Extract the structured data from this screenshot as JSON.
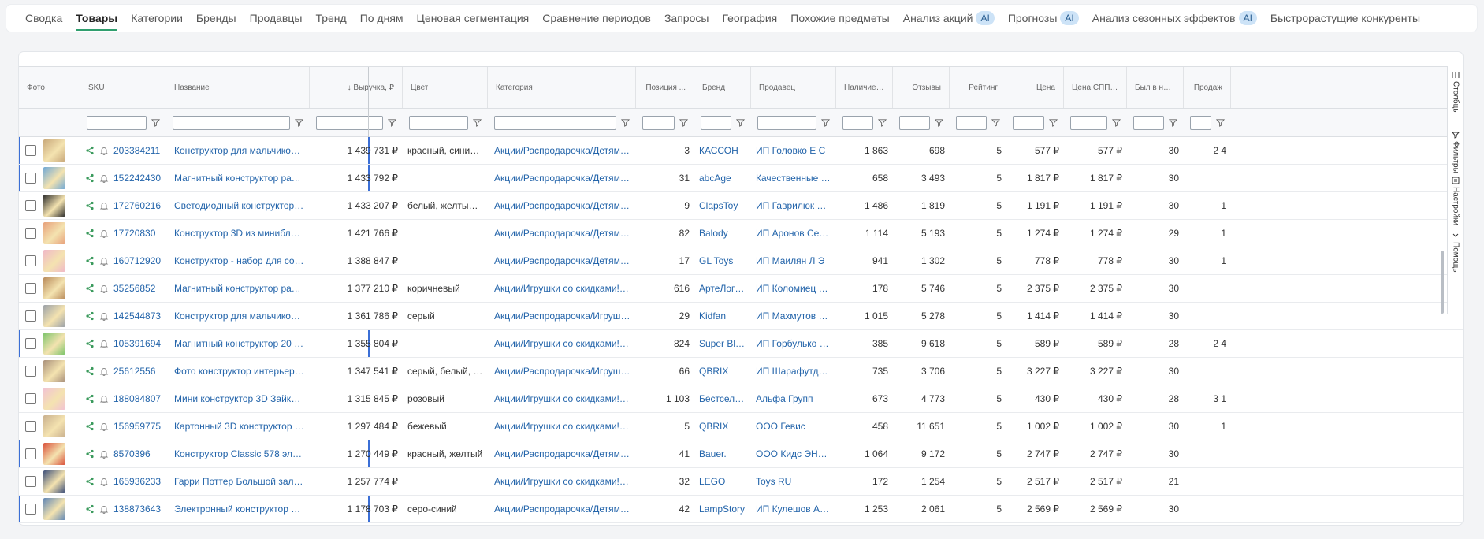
{
  "tabs": [
    {
      "label": "Сводка",
      "active": false,
      "ai": false
    },
    {
      "label": "Товары",
      "active": true,
      "ai": false
    },
    {
      "label": "Категории",
      "active": false,
      "ai": false
    },
    {
      "label": "Бренды",
      "active": false,
      "ai": false
    },
    {
      "label": "Продавцы",
      "active": false,
      "ai": false
    },
    {
      "label": "Тренд",
      "active": false,
      "ai": false
    },
    {
      "label": "По дням",
      "active": false,
      "ai": false
    },
    {
      "label": "Ценовая сегментация",
      "active": false,
      "ai": false
    },
    {
      "label": "Сравнение периодов",
      "active": false,
      "ai": false
    },
    {
      "label": "Запросы",
      "active": false,
      "ai": false
    },
    {
      "label": "География",
      "active": false,
      "ai": false
    },
    {
      "label": "Похожие предметы",
      "active": false,
      "ai": false
    },
    {
      "label": "Анализ акций",
      "active": false,
      "ai": true
    },
    {
      "label": "Прогнозы",
      "active": false,
      "ai": true
    },
    {
      "label": "Анализ сезонных эффектов",
      "active": false,
      "ai": true
    },
    {
      "label": "Быстрорастущие конкуренты",
      "active": false,
      "ai": false
    }
  ],
  "ai_label": "AI",
  "columns": [
    {
      "key": "photo",
      "label": "Фото",
      "filter": false
    },
    {
      "key": "sku",
      "label": "SKU",
      "filter": true
    },
    {
      "key": "name",
      "label": "Название",
      "filter": true
    },
    {
      "key": "revenue",
      "label": "↓ Выручка, ₽",
      "filter": true
    },
    {
      "key": "color",
      "label": "Цвет",
      "filter": true
    },
    {
      "key": "category",
      "label": "Категория",
      "filter": true
    },
    {
      "key": "position",
      "label": "Позиция ...",
      "filter": true
    },
    {
      "key": "brand",
      "label": "Бренд",
      "filter": true
    },
    {
      "key": "seller",
      "label": "Продавец",
      "filter": true
    },
    {
      "key": "stock",
      "label": "Наличие, ...",
      "filter": true
    },
    {
      "key": "reviews",
      "label": "Отзывы",
      "filter": true
    },
    {
      "key": "rating",
      "label": "Рейтинг",
      "filter": true
    },
    {
      "key": "price",
      "label": "Цена",
      "filter": true
    },
    {
      "key": "price_spp",
      "label": "Цена СПП, ₽",
      "filter": true
    },
    {
      "key": "days",
      "label": "Был в нал...",
      "filter": true
    },
    {
      "key": "sales",
      "label": "Продаж",
      "filter": true
    }
  ],
  "rows": [
    {
      "sku": "203384211",
      "name": "Конструктор для мальчиков дево...",
      "revenue": "1 439 731 ₽",
      "color": "красный, синий, ...",
      "category": "Акции/Распродарочка/Детям/Под...",
      "position": "3",
      "brand": "КАССОН",
      "seller": "ИП Головко Е С",
      "stock": "1 863",
      "reviews": "698",
      "rating": "5",
      "price": "577 ₽",
      "price_spp": "577 ₽",
      "days": "30",
      "sales": "2 4",
      "pinned": true,
      "thumb": "#c8a87a"
    },
    {
      "sku": "152242430",
      "name": "Магнитный конструктор развива...",
      "revenue": "1 433 792 ₽",
      "color": "",
      "category": "Акции/Распродарочка/Детям/Под...",
      "position": "31",
      "brand": "abcAge",
      "seller": "Качественные Тов...",
      "stock": "658",
      "reviews": "3 493",
      "rating": "5",
      "price": "1 817 ₽",
      "price_spp": "1 817 ₽",
      "days": "30",
      "sales": "",
      "pinned": true,
      "thumb": "#6fa8d6"
    },
    {
      "sku": "172760216",
      "name": "Светодиодный конструктор косм...",
      "revenue": "1 433 207 ₽",
      "color": "белый, желтый, з...",
      "category": "Акции/Распродарочка/Детям/Под...",
      "position": "9",
      "brand": "ClapsToy",
      "seller": "ИП Гаврилюк Р Н",
      "stock": "1 486",
      "reviews": "1 819",
      "rating": "5",
      "price": "1 191 ₽",
      "price_spp": "1 191 ₽",
      "days": "30",
      "sales": "1",
      "pinned": false,
      "thumb": "#2b2b2b"
    },
    {
      "sku": "17720830",
      "name": "Конструктор 3D из миниблоков \"...",
      "revenue": "1 421 766 ₽",
      "color": "",
      "category": "Акции/Распродарочка/Детям/Под...",
      "position": "82",
      "brand": "Balody",
      "seller": "ИП Аронов Серге...",
      "stock": "1 114",
      "reviews": "5 193",
      "rating": "5",
      "price": "1 274 ₽",
      "price_spp": "1 274 ₽",
      "days": "29",
      "sales": "1",
      "pinned": false,
      "thumb": "#e7a07a"
    },
    {
      "sku": "160712920",
      "name": "Конструктор - набор для создани...",
      "revenue": "1 388 847 ₽",
      "color": "",
      "category": "Акции/Распродарочка/Детям/Под...",
      "position": "17",
      "brand": "GL Toys",
      "seller": "ИП Маилян Л Э",
      "stock": "941",
      "reviews": "1 302",
      "rating": "5",
      "price": "778 ₽",
      "price_spp": "778 ₽",
      "days": "30",
      "sales": "1",
      "pinned": false,
      "thumb": "#f0b8c8"
    },
    {
      "sku": "35256852",
      "name": "Магнитный конструктор развива...",
      "revenue": "1 377 210 ₽",
      "color": "коричневый",
      "category": "Акции/Игрушки со скидками!/Дет...",
      "position": "616",
      "brand": "АртеЛогика",
      "seller": "ИП Коломиец Т Н",
      "stock": "178",
      "reviews": "5 746",
      "rating": "5",
      "price": "2 375 ₽",
      "price_spp": "2 375 ₽",
      "days": "30",
      "sales": "",
      "pinned": false,
      "thumb": "#b88a5a"
    },
    {
      "sku": "142544873",
      "name": "Конструктор для мальчиков Кора...",
      "revenue": "1 361 786 ₽",
      "color": "серый",
      "category": "Акции/Распродарочка/Игрушки/К...",
      "position": "29",
      "brand": "Kidfan",
      "seller": "ИП Махмутов А Ф",
      "stock": "1 015",
      "reviews": "5 278",
      "rating": "5",
      "price": "1 414 ₽",
      "price_spp": "1 414 ₽",
      "days": "30",
      "sales": "",
      "pinned": false,
      "thumb": "#9aa0a8"
    },
    {
      "sku": "105391694",
      "name": "Магнитный конструктор 20 детал...",
      "revenue": "1 355 804 ₽",
      "color": "",
      "category": "Акции/Игрушки со скидками!/Дет...",
      "position": "824",
      "brand": "Super Bloc...",
      "seller": "ИП Горбулько Н В",
      "stock": "385",
      "reviews": "9 618",
      "rating": "5",
      "price": "589 ₽",
      "price_spp": "589 ₽",
      "days": "28",
      "sales": "2 4",
      "pinned": true,
      "thumb": "#7bc46a"
    },
    {
      "sku": "25612556",
      "name": "Фото конструктор интерьерный ...",
      "revenue": "1 347 541 ₽",
      "color": "серый, белый, те...",
      "category": "Акции/Распродарочка/Игрушки/К...",
      "position": "66",
      "brand": "QBRIX",
      "seller": "ИП Шарафутдино...",
      "stock": "735",
      "reviews": "3 706",
      "rating": "5",
      "price": "3 227 ₽",
      "price_spp": "3 227 ₽",
      "days": "30",
      "sales": "",
      "pinned": false,
      "thumb": "#a88f7a"
    },
    {
      "sku": "188084807",
      "name": "Мини конструктор 3D Зайка Май ...",
      "revenue": "1 315 845 ₽",
      "color": "розовый",
      "category": "Акции/Игрушки со скидками!/Дет...",
      "position": "1 103",
      "brand": "Бестселлер",
      "seller": "Альфа Групп",
      "stock": "673",
      "reviews": "4 773",
      "rating": "5",
      "price": "430 ₽",
      "price_spp": "430 ₽",
      "days": "28",
      "sales": "3 1",
      "pinned": false,
      "thumb": "#f2c2d4"
    },
    {
      "sku": "156959775",
      "name": "Картонный 3D конструктор интер...",
      "revenue": "1 297 484 ₽",
      "color": "бежевый",
      "category": "Акции/Игрушки со скидками!/Дет...",
      "position": "5",
      "brand": "QBRIX",
      "seller": "ООО Гевис",
      "stock": "458",
      "reviews": "11 651",
      "rating": "5",
      "price": "1 002 ₽",
      "price_spp": "1 002 ₽",
      "days": "30",
      "sales": "1",
      "pinned": false,
      "thumb": "#c9b08e"
    },
    {
      "sku": "8570396",
      "name": "Конструктор Classic 578 элементов",
      "revenue": "1 270 449 ₽",
      "color": "красный, желтый",
      "category": "Акции/Распродарочка/Детям/Под...",
      "position": "41",
      "brand": "Bauer.",
      "seller": "ООО Кидс ЭНД КЭР",
      "stock": "1 064",
      "reviews": "9 172",
      "rating": "5",
      "price": "2 747 ₽",
      "price_spp": "2 747 ₽",
      "days": "30",
      "sales": "",
      "pinned": true,
      "thumb": "#d9503a"
    },
    {
      "sku": "165936233",
      "name": "Гарри Поттер Большой зал Хогва...",
      "revenue": "1 257 774 ₽",
      "color": "",
      "category": "Акции/Игрушки со скидками!/Игр...",
      "position": "32",
      "brand": "LEGO",
      "seller": "Toys RU",
      "stock": "172",
      "reviews": "1 254",
      "rating": "5",
      "price": "2 517 ₽",
      "price_spp": "2 517 ₽",
      "days": "21",
      "sales": "",
      "pinned": false,
      "thumb": "#3d4f7a"
    },
    {
      "sku": "138873643",
      "name": "Электронный конструктор для ма...",
      "revenue": "1 178 703 ₽",
      "color": "серо-синий",
      "category": "Акции/Распродарочка/Детям/Под...",
      "position": "42",
      "brand": "LampStory",
      "seller": "ИП Кулешов Анд...",
      "stock": "1 253",
      "reviews": "2 061",
      "rating": "5",
      "price": "2 569 ₽",
      "price_spp": "2 569 ₽",
      "days": "30",
      "sales": "",
      "pinned": true,
      "thumb": "#5f86b5"
    }
  ],
  "side_panel": [
    {
      "label": "Столбцы",
      "icon": "columns-icon"
    },
    {
      "label": "Фильтры",
      "icon": "filter-icon"
    },
    {
      "label": "Настройки",
      "icon": "settings-icon"
    },
    {
      "label": "Помощь",
      "icon": "help-icon"
    }
  ],
  "colors": {
    "link": "#2364aa",
    "accent": "#2f9e6e",
    "pin": "#3b6fd6",
    "ai_badge": "#cde3f7"
  }
}
